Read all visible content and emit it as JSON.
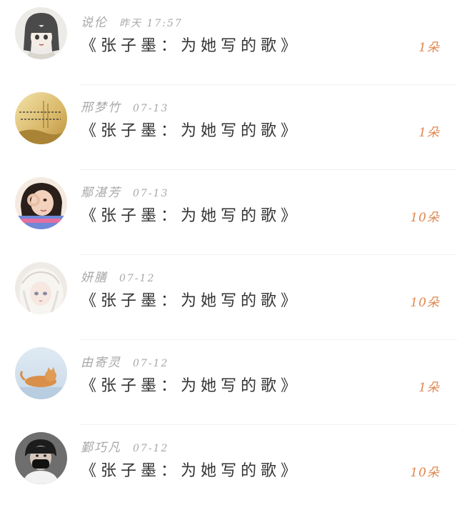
{
  "messages": [
    {
      "name": "说伦",
      "time": "昨天 17:57",
      "title": "《张子墨：为她写的歌》",
      "count": "1朵",
      "avatar": "anime-girl-sketch-avatar"
    },
    {
      "name": "邢梦竹",
      "time": "07-13",
      "title": "《张子墨：为她写的歌》",
      "count": "1朵",
      "avatar": "golden-field-quote-avatar"
    },
    {
      "name": "鄢湛芳",
      "time": "07-13",
      "title": "《张子墨：为她写的歌》",
      "count": "10朵",
      "avatar": "girl-ok-hand-avatar"
    },
    {
      "name": "妍膳",
      "time": "07-12",
      "title": "《张子墨：为她写的歌》",
      "count": "10朵",
      "avatar": "anime-white-hair-avatar"
    },
    {
      "name": "由寄灵",
      "time": "07-12",
      "title": "《张子墨：为她写的歌》",
      "count": "1朵",
      "avatar": "cat-avatar"
    },
    {
      "name": "鄞巧凡",
      "time": "07-12",
      "title": "《张子墨：为她写的歌》",
      "count": "10朵",
      "avatar": "masked-boy-avatar"
    }
  ],
  "colors": {
    "meta": "#a8a8a8",
    "title": "#333333",
    "count": "#e0874e",
    "divider": "#f0f0f0"
  }
}
